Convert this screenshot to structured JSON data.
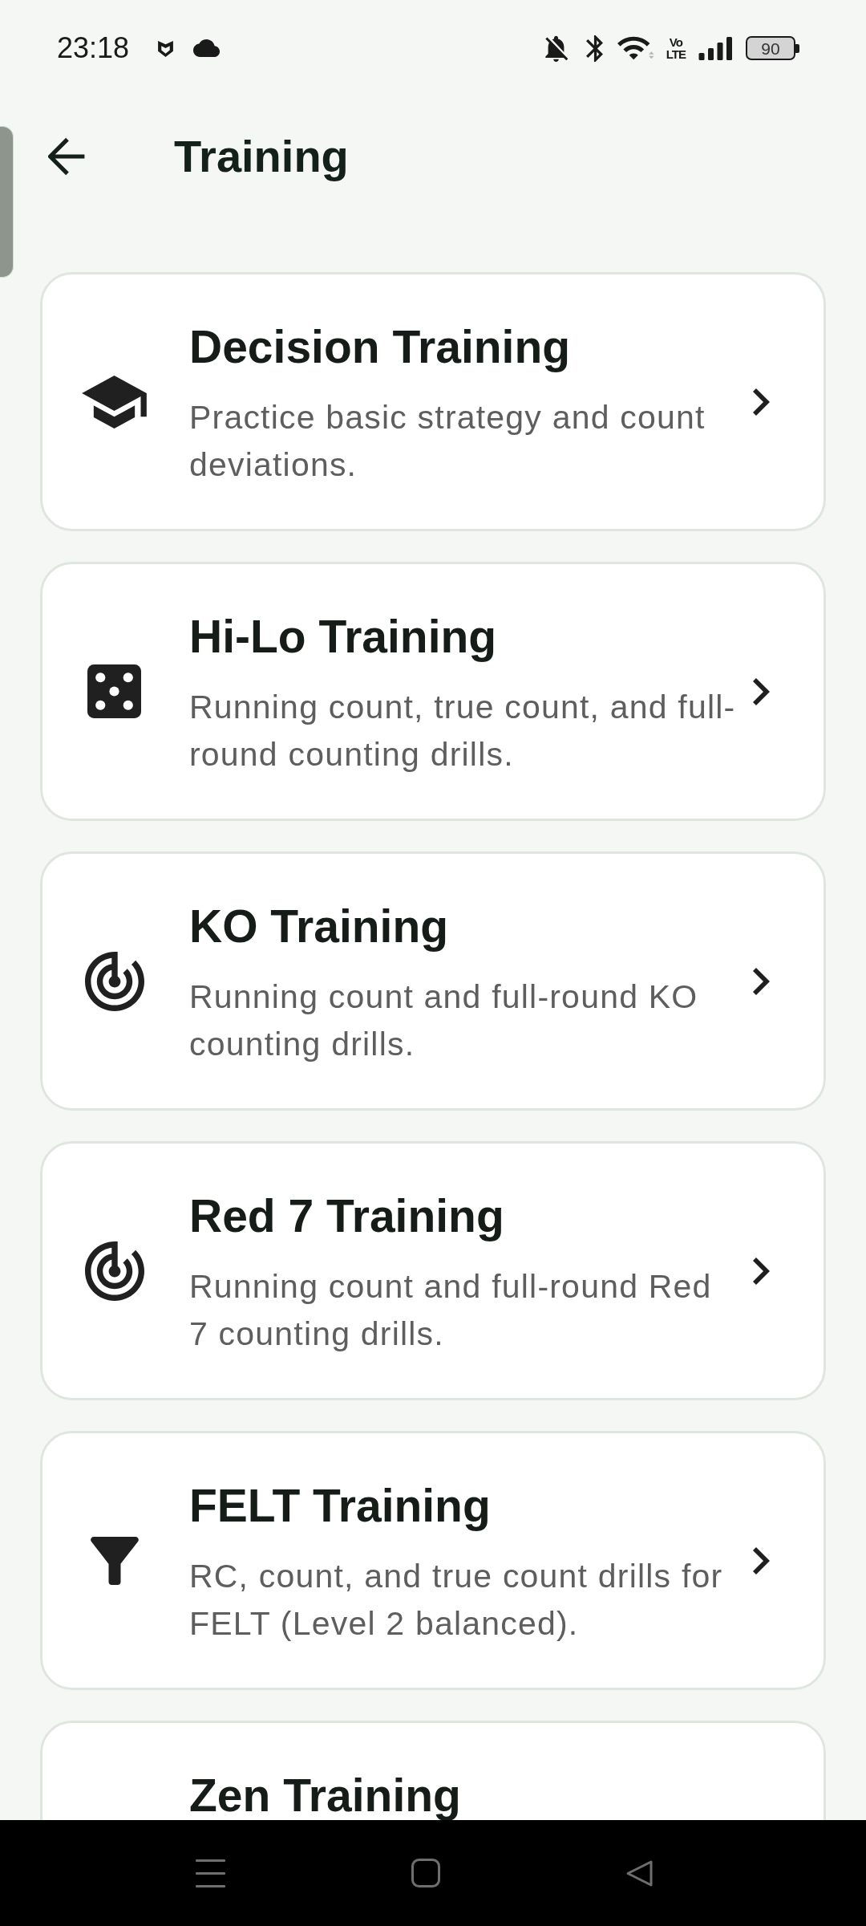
{
  "status_bar": {
    "time": "23:18",
    "network_type": [
      "Vo",
      "LTE"
    ],
    "battery": "90"
  },
  "header": {
    "title": "Training"
  },
  "trainings": [
    {
      "title": "Decision Training",
      "description": "Practice basic strategy and count deviations."
    },
    {
      "title": "Hi-Lo Training",
      "description": "Running count, true count, and full-round counting drills."
    },
    {
      "title": "KO Training",
      "description": "Running count and full-round KO counting drills."
    },
    {
      "title": "Red 7 Training",
      "description": "Running count and full-round Red 7 counting drills."
    },
    {
      "title": "FELT Training",
      "description": "RC, count, and true count drills for FELT (Level 2 balanced)."
    },
    {
      "title": "Zen Training"
    }
  ]
}
